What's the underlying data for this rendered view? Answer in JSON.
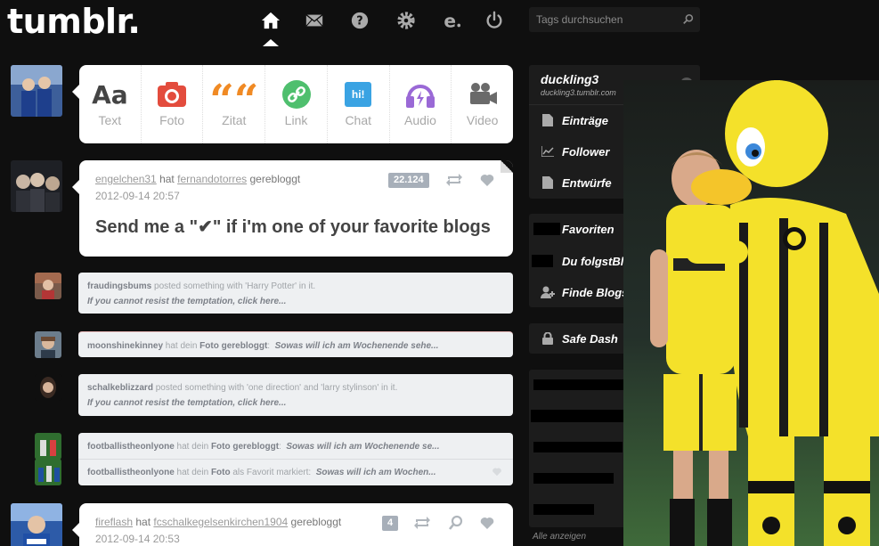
{
  "header": {
    "logo": "tumblr.",
    "search_placeholder": "Tags durchsuchen",
    "nav_icons": [
      "home-icon",
      "mail-icon",
      "help-icon",
      "gear-icon",
      "edit-icon",
      "power-icon"
    ]
  },
  "composer": {
    "types": [
      {
        "label": "Text",
        "icon": "text-icon",
        "color": "#444444",
        "glyph": "Aa"
      },
      {
        "label": "Foto",
        "icon": "camera-icon",
        "color": "#e34c3d"
      },
      {
        "label": "Zitat",
        "icon": "quote-icon",
        "color": "#f08a24",
        "glyph": "““"
      },
      {
        "label": "Link",
        "icon": "link-icon",
        "color": "#4fbf6e"
      },
      {
        "label": "Chat",
        "icon": "chat-icon",
        "color": "#3aa3e3",
        "glyph": "hi!"
      },
      {
        "label": "Audio",
        "icon": "audio-icon",
        "color": "#9a69d6"
      },
      {
        "label": "Video",
        "icon": "video-camera-icon",
        "color": "#6a6a6a"
      }
    ]
  },
  "posts": [
    {
      "user": "engelchen31",
      "verb": "hat",
      "source": "fernandotorres",
      "action": "gerebloggt",
      "date": "2012-09-14 20:57",
      "notes": "22.124",
      "text": "Send me a \"✔\" if i'm one of your favorite blogs"
    },
    {
      "user": "fireflash",
      "verb": "hat",
      "source": "fcschalkegelsenkirchen1904",
      "action": "gerebloggt",
      "date": "2012-09-14 20:53",
      "notes": "4"
    }
  ],
  "notifications": [
    {
      "user": "fraudingsbums",
      "text": " posted something with 'Harry Potter' in it.",
      "sub": "If you cannot resist the temptation, click here..."
    },
    {
      "user": "moonshinekinney",
      "text": " hat dein ",
      "strong": "Foto gerebloggt",
      "quote": "Sowas will ich am Wochenende sehe..."
    },
    {
      "user": "schalkeblizzard",
      "text": " posted something with 'one direction' and 'larry stylinson' in it.",
      "sub": "If you cannot resist the temptation, click here..."
    },
    {
      "user": "footballistheonlyone",
      "text": " hat dein ",
      "strong": "Foto gerebloggt",
      "quote": "Sowas will ich am Wochenende se..."
    },
    {
      "user": "footballistheonlyone",
      "text": " hat dein ",
      "strong": "Foto",
      "text2": " als Favorit markiert:",
      "quote": "Sowas will ich am Wochen..."
    }
  ],
  "sidebar": {
    "blog": {
      "name": "duckling3",
      "url": "duckling3.tumblr.com"
    },
    "blog_items": [
      {
        "label": "Einträge",
        "icon": "posts-icon"
      },
      {
        "label": "Follower",
        "icon": "followers-chart-icon"
      },
      {
        "label": "Entwürfe",
        "icon": "drafts-icon"
      }
    ],
    "account_items": [
      {
        "label": "Favoriten",
        "icon": "heart-icon"
      },
      {
        "label": "Du folgst",
        "label2": "Blogs",
        "icon": "person-icon"
      },
      {
        "label": "Finde Blogs",
        "icon": "add-person-icon"
      }
    ],
    "safe_dash": {
      "label": "Safe Dash",
      "icon": "lock-icon"
    },
    "see_all": "Alle anzeigen"
  },
  "colors": {
    "background": "#0f0f0f",
    "sidebar_block": "#1c1c1c",
    "note_badge": "#a7afb9",
    "dortmund_yellow": "#f4e12a"
  }
}
